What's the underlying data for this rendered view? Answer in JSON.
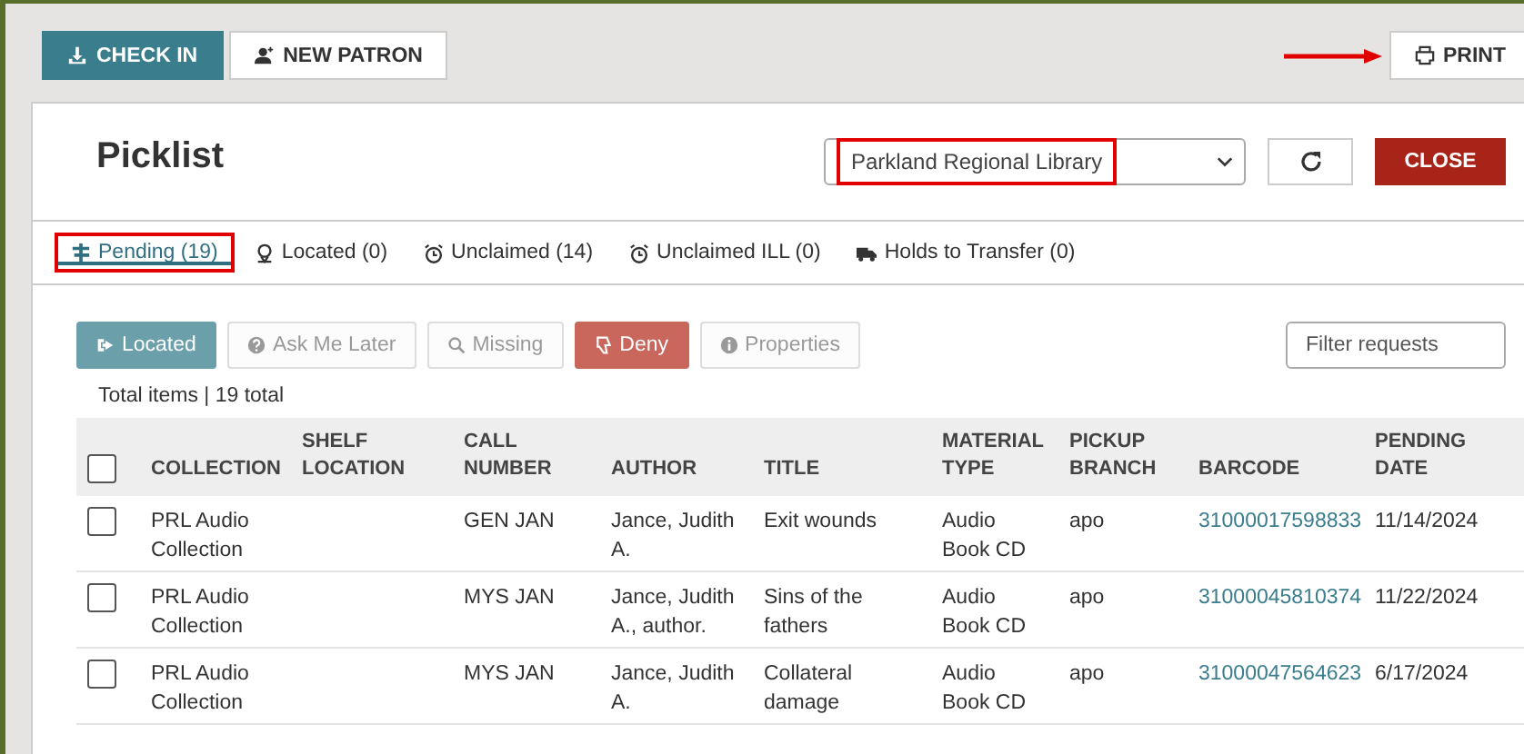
{
  "toolbar": {
    "buttons": [
      {
        "label": "CHECK IN",
        "kind": "primary"
      },
      {
        "label": "NEW PATRON",
        "kind": "plain"
      }
    ],
    "print": {
      "label": "PRINT",
      "pointed": true
    }
  },
  "panel": {
    "title": "Picklist",
    "branch_select": {
      "value": "Parkland Regional Library",
      "highlighted": true
    },
    "close": "CLOSE"
  },
  "tabs": [
    {
      "label": "Pending (19)",
      "selected": true,
      "highlighted": true
    },
    {
      "label": "Located (0)",
      "selected": false,
      "highlighted": false
    },
    {
      "label": "Unclaimed (14)",
      "selected": false,
      "highlighted": false
    },
    {
      "label": "Unclaimed ILL (0)",
      "selected": false,
      "highlighted": false
    },
    {
      "label": "Holds to Transfer (0)",
      "selected": false,
      "highlighted": false
    }
  ],
  "actions": [
    {
      "label": "Located",
      "kind": "teal",
      "disabled": false
    },
    {
      "label": "Ask Me Later",
      "kind": "plain",
      "disabled": true
    },
    {
      "label": "Missing",
      "kind": "plain",
      "disabled": true
    },
    {
      "label": "Deny",
      "kind": "red",
      "disabled": false
    },
    {
      "label": "Properties",
      "kind": "plain",
      "disabled": true
    }
  ],
  "filter": {
    "placeholder": "Filter requests"
  },
  "total": "Total items | 19 total",
  "table": {
    "select_all_checked": false,
    "columns": [
      "COLLECTION",
      "SHELF LOCATION",
      "CALL NUMBER",
      "AUTHOR",
      "TITLE",
      "MATERIAL TYPE",
      "PICKUP BRANCH",
      "BARCODE",
      "PENDING DATE"
    ],
    "rows": [
      {
        "checked": false,
        "cells": [
          "PRL Audio Collection",
          "",
          "GEN JAN",
          "Jance, Judith A.",
          "Exit wounds",
          "Audio Book CD",
          "apo",
          "31000017598833",
          "11/14/2024"
        ]
      },
      {
        "checked": false,
        "cells": [
          "PRL Audio Collection",
          "",
          "MYS JAN",
          "Jance, Judith A., author.",
          "Sins of the fathers",
          "Audio Book CD",
          "apo",
          "31000045810374",
          "11/22/2024"
        ]
      },
      {
        "checked": false,
        "cells": [
          "PRL Audio Collection",
          "",
          "MYS JAN",
          "Jance, Judith A.",
          "Collateral damage",
          "Audio Book CD",
          "apo",
          "31000047564623",
          "6/17/2024"
        ]
      }
    ]
  }
}
